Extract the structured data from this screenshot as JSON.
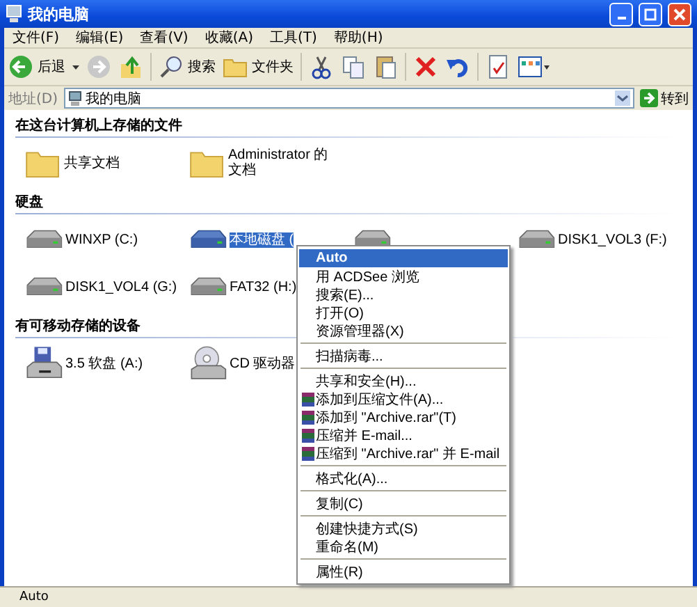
{
  "window": {
    "title": "我的电脑"
  },
  "menu_bar": [
    "文件(F)",
    "编辑(E)",
    "查看(V)",
    "收藏(A)",
    "工具(T)",
    "帮助(H)"
  ],
  "toolbar": {
    "back": "后退",
    "search": "搜索",
    "folders": "文件夹"
  },
  "address_bar": {
    "label": "地址(D)",
    "value": "我的电脑",
    "go": "转到"
  },
  "sections": [
    {
      "title": "在这台计算机上存储的文件",
      "items": [
        {
          "kind": "folder",
          "label": "共享文档",
          "selected": false
        },
        {
          "kind": "folder",
          "label": "Administrator 的文档",
          "selected": false
        }
      ]
    },
    {
      "title": "硬盘",
      "items": [
        {
          "kind": "drive",
          "label": "WINXP (C:)",
          "selected": false
        },
        {
          "kind": "drive",
          "label": "本地磁盘 (",
          "selected": true
        },
        {
          "kind": "drive",
          "selected": false
        },
        {
          "kind": "drive",
          "label": "DISK1_VOL3 (F:)",
          "selected": false
        },
        {
          "kind": "drive",
          "label": "DISK1_VOL4 (G:)",
          "selected": false
        },
        {
          "kind": "drive",
          "label": "FAT32 (H:)",
          "selected": false
        }
      ]
    },
    {
      "title": "有可移动存储的设备",
      "items": [
        {
          "kind": "floppy",
          "label": "3.5 软盘 (A:)",
          "selected": false
        },
        {
          "kind": "cd",
          "label": "CD 驱动器",
          "selected": false
        }
      ]
    }
  ],
  "context_menu": [
    {
      "kind": "item",
      "label": "Auto",
      "default": true,
      "selected": true
    },
    {
      "kind": "item",
      "label": "用 ACDSee 浏览",
      "selected": false
    },
    {
      "kind": "item",
      "label": "搜索(E)...",
      "selected": false
    },
    {
      "kind": "item",
      "label": "打开(O)",
      "selected": false
    },
    {
      "kind": "item",
      "label": "资源管理器(X)",
      "selected": false
    },
    {
      "kind": "separator"
    },
    {
      "kind": "item",
      "label": "扫描病毒...",
      "selected": false
    },
    {
      "kind": "separator"
    },
    {
      "kind": "item",
      "label": "共享和安全(H)...",
      "selected": false
    },
    {
      "kind": "archive",
      "label": "添加到压缩文件(A)...",
      "selected": false
    },
    {
      "kind": "archive",
      "label": "添加到 \"Archive.rar\"(T)",
      "selected": false
    },
    {
      "kind": "archive",
      "label": "压缩并 E-mail...",
      "selected": false
    },
    {
      "kind": "archive",
      "label": "压缩到 \"Archive.rar\" 并 E-mail",
      "selected": false
    },
    {
      "kind": "separator"
    },
    {
      "kind": "item",
      "label": "格式化(A)...",
      "selected": false
    },
    {
      "kind": "separator"
    },
    {
      "kind": "item",
      "label": "复制(C)",
      "selected": false
    },
    {
      "kind": "separator"
    },
    {
      "kind": "item",
      "label": "创建快捷方式(S)",
      "selected": false
    },
    {
      "kind": "item",
      "label": "重命名(M)",
      "selected": false
    },
    {
      "kind": "separator"
    },
    {
      "kind": "item",
      "label": "属性(R)",
      "selected": false
    }
  ],
  "status_bar": "Auto"
}
